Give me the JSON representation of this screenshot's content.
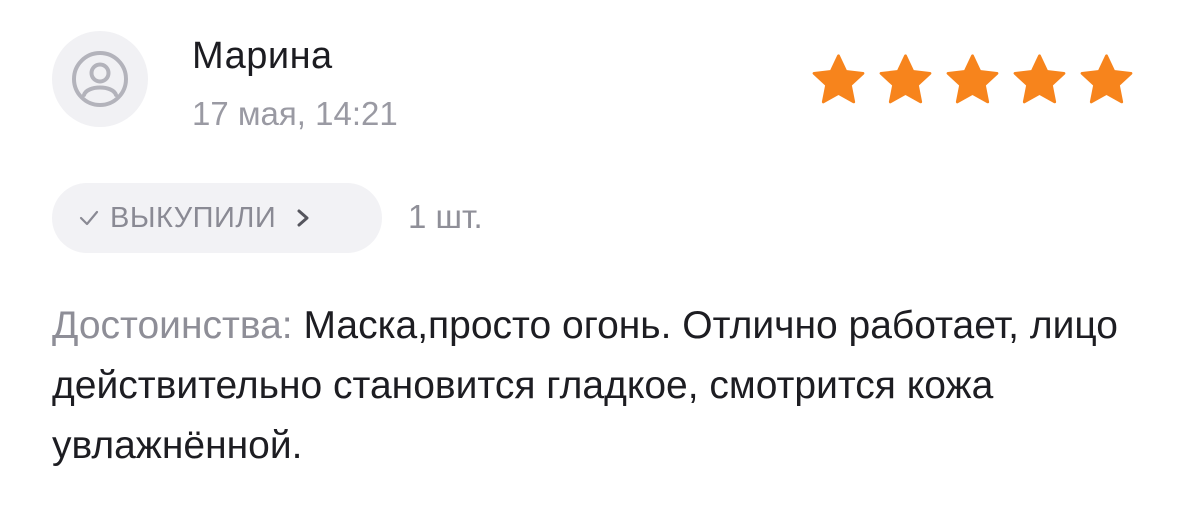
{
  "review": {
    "author": "Марина",
    "date": "17 мая, 14:21",
    "rating": 5,
    "rating_max": 5,
    "star_color": "#F7841C",
    "avatar_icon": "user-icon",
    "badge": {
      "check_icon": "check-icon",
      "label": "ВЫКУПИЛИ",
      "chevron_icon": "chevron-right-icon"
    },
    "quantity": "1 шт.",
    "pros_label": "Достоинства:",
    "pros_text": "Маска,просто огонь. Отлично работает, лицо действительно становится гладкое, смотрится кожа  увлажнённой."
  }
}
